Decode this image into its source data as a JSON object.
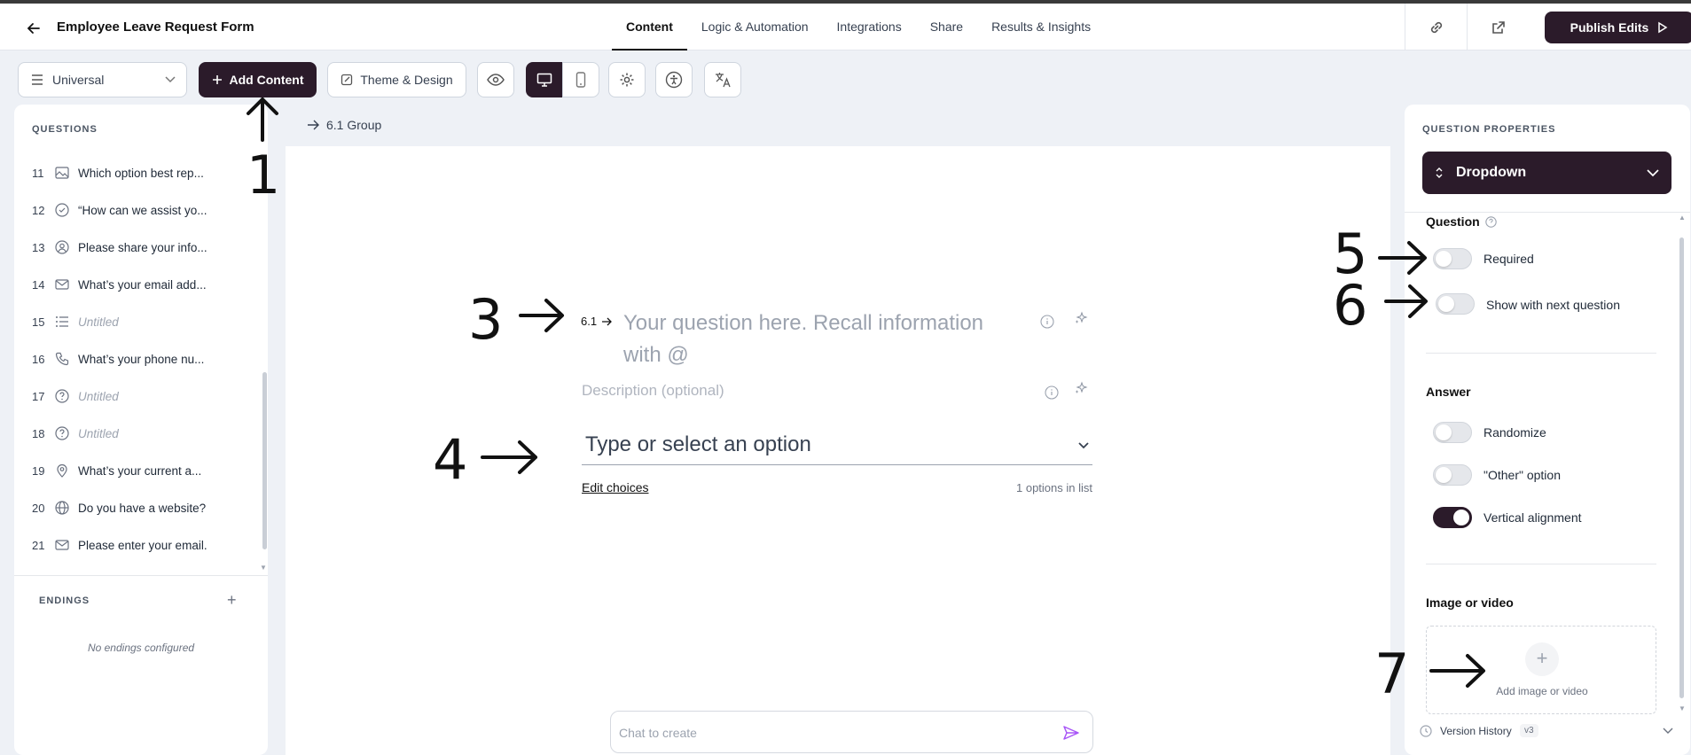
{
  "header": {
    "title": "Employee Leave Request Form",
    "tabs": [
      "Content",
      "Logic & Automation",
      "Integrations",
      "Share",
      "Results & Insights"
    ],
    "publish_label": "Publish Edits"
  },
  "toolbar": {
    "language_select": "Universal",
    "add_content_label": "Add Content",
    "theme_label": "Theme & Design"
  },
  "questions_panel": {
    "heading": "QUESTIONS",
    "items": [
      {
        "num": "11",
        "icon": "image-icon",
        "text": "Which option best rep...",
        "untitled": false
      },
      {
        "num": "12",
        "icon": "check-circle-icon",
        "text": "“How can we assist yo...",
        "untitled": false
      },
      {
        "num": "13",
        "icon": "user-circle-icon",
        "text": "Please share your info...",
        "untitled": false
      },
      {
        "num": "14",
        "icon": "mail-icon",
        "text": "What’s your email add...",
        "untitled": false
      },
      {
        "num": "15",
        "icon": "list-icon",
        "text": "Untitled",
        "untitled": true
      },
      {
        "num": "16",
        "icon": "phone-icon",
        "text": "What’s your phone nu...",
        "untitled": false
      },
      {
        "num": "17",
        "icon": "help-circle-icon",
        "text": "Untitled",
        "untitled": true
      },
      {
        "num": "18",
        "icon": "help-circle-icon",
        "text": "Untitled",
        "untitled": true
      },
      {
        "num": "19",
        "icon": "location-pin-icon",
        "text": "What’s your current a...",
        "untitled": false
      },
      {
        "num": "20",
        "icon": "globe-icon",
        "text": "Do you have a website?",
        "untitled": false
      },
      {
        "num": "21",
        "icon": "mail-icon",
        "text": "Please enter your email.",
        "untitled": false
      }
    ],
    "endings_heading": "ENDINGS",
    "endings_empty": "No endings configured"
  },
  "canvas": {
    "breadcrumb": "6.1 Group",
    "question_number": "6.1",
    "question_placeholder_line1": "Your question here. Recall information",
    "question_placeholder_line2": "with @",
    "description_placeholder": "Description (optional)",
    "dropdown_placeholder": "Type or select an option",
    "edit_choices": "Edit choices",
    "options_count": "1 options in list",
    "chat_placeholder": "Chat to create"
  },
  "properties": {
    "heading": "QUESTION PROPERTIES",
    "type_label": "Dropdown",
    "question_section": "Question",
    "required_label": "Required",
    "show_next_label": "Show with next question",
    "answer_section": "Answer",
    "randomize_label": "Randomize",
    "other_label": "\"Other\" option",
    "vertical_label": "Vertical alignment",
    "vertical_on": true,
    "media_section": "Image or video",
    "add_media_label": "Add image or video",
    "version_history_label": "Version History",
    "version_badge": "v3"
  },
  "annotations": [
    "1",
    "3",
    "4",
    "5",
    "6",
    "7"
  ],
  "colors": {
    "primary_dark": "#2b1b2a",
    "background": "#eef1f6"
  }
}
